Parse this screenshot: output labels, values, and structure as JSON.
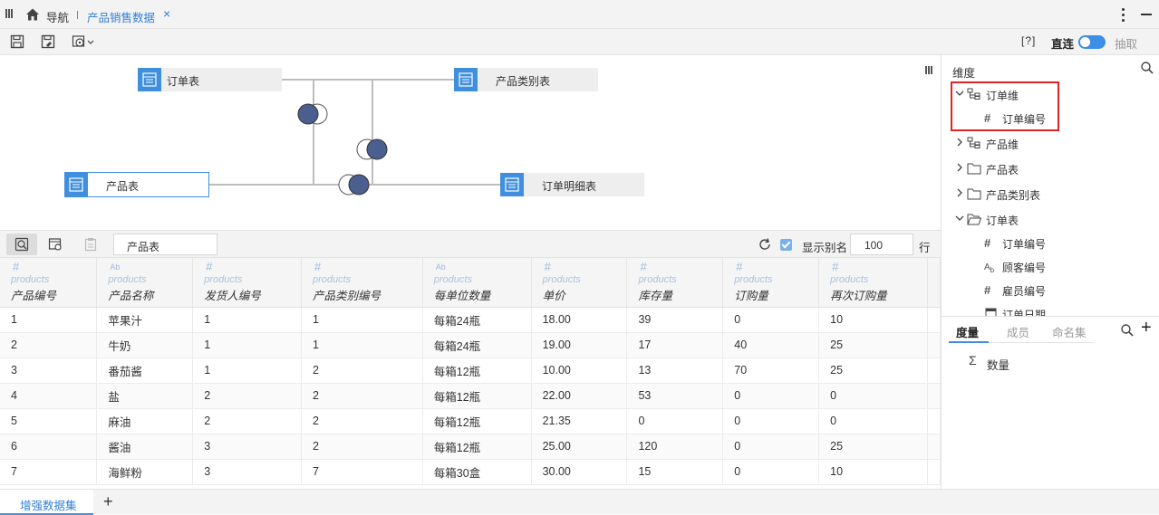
{
  "topbar": {
    "nav_label": "导航",
    "tab_label": "产品销售数据",
    "tab_close": "×"
  },
  "toolbar": {
    "help": "[?]",
    "direct_label": "直连",
    "extract_label": "抽取"
  },
  "diagram": {
    "nodes": [
      {
        "label": "订单表"
      },
      {
        "label": "产品类别表"
      },
      {
        "label": "产品表"
      },
      {
        "label": "订单明细表"
      }
    ]
  },
  "datatoolbar": {
    "dataset_name": "产品表",
    "alias_label": "显示别名",
    "alias_checked": true,
    "rows_value": "100",
    "rows_unit": "行"
  },
  "grid": {
    "columns": [
      {
        "type": "#",
        "source": "products",
        "name": "产品编号"
      },
      {
        "type": "Ab",
        "source": "products",
        "name": "产品名称"
      },
      {
        "type": "#",
        "source": "products",
        "name": "发货人编号"
      },
      {
        "type": "#",
        "source": "products",
        "name": "产品类别编号"
      },
      {
        "type": "Ab",
        "source": "products",
        "name": "每单位数量"
      },
      {
        "type": "#",
        "source": "products",
        "name": "单价"
      },
      {
        "type": "#",
        "source": "products",
        "name": "库存量"
      },
      {
        "type": "#",
        "source": "products",
        "name": "订购量"
      },
      {
        "type": "#",
        "source": "products",
        "name": "再次订购量"
      }
    ],
    "rows": [
      [
        "1",
        "苹果汁",
        "1",
        "1",
        "每箱24瓶",
        "18.00",
        "39",
        "0",
        "10"
      ],
      [
        "2",
        "牛奶",
        "1",
        "1",
        "每箱24瓶",
        "19.00",
        "17",
        "40",
        "25"
      ],
      [
        "3",
        "番茄酱",
        "1",
        "2",
        "每箱12瓶",
        "10.00",
        "13",
        "70",
        "25"
      ],
      [
        "4",
        "盐",
        "2",
        "2",
        "每箱12瓶",
        "22.00",
        "53",
        "0",
        "0"
      ],
      [
        "5",
        "麻油",
        "2",
        "2",
        "每箱12瓶",
        "21.35",
        "0",
        "0",
        "0"
      ],
      [
        "6",
        "酱油",
        "3",
        "2",
        "每箱12瓶",
        "25.00",
        "120",
        "0",
        "25"
      ],
      [
        "7",
        "海鲜粉",
        "3",
        "7",
        "每箱30盒",
        "30.00",
        "15",
        "0",
        "10"
      ]
    ]
  },
  "bottombar": {
    "tab_label": "增强数据集",
    "add": "+"
  },
  "rightpanel": {
    "title": "维度",
    "tree": [
      {
        "label": "订单维",
        "expanded": true
      },
      {
        "label": "订单编号"
      },
      {
        "label": "产品维",
        "expanded": false
      },
      {
        "label": "产品表",
        "expanded": false
      },
      {
        "label": "产品类别表",
        "expanded": false
      },
      {
        "label": "订单表",
        "expanded": true
      },
      {
        "label": "订单编号"
      },
      {
        "label": "顾客编号"
      },
      {
        "label": "雇员编号"
      },
      {
        "label": "订单日期"
      }
    ],
    "tabs": [
      "度量",
      "成员",
      "命名集"
    ],
    "measure": "数量",
    "measure_icon": "Σ"
  }
}
